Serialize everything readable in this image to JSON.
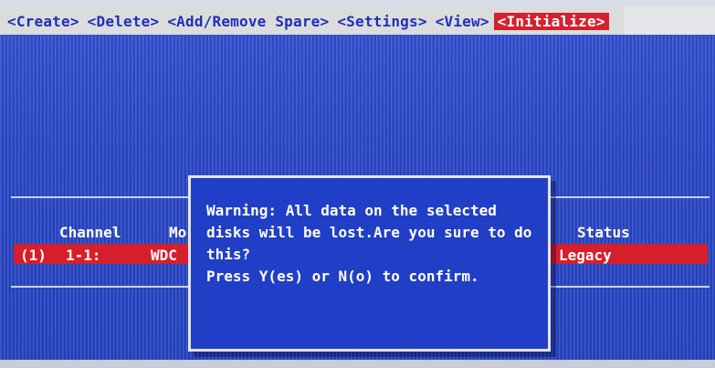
{
  "menu": {
    "items": [
      "<Create>",
      "<Delete>",
      "<Add/Remove Spare>",
      "<Settings>",
      "<View>"
    ],
    "active_item": "<Initialize>"
  },
  "table": {
    "headers": {
      "channel": "Channel",
      "model": "Mo",
      "status": "Status"
    },
    "row": {
      "index": "(1)",
      "channel": "1-1:",
      "model": "WDC",
      "status": "Legacy"
    }
  },
  "dialog": {
    "lines": [
      "Warning: All data on the selected",
      "disks will be lost.Are you sure to do",
      "this?",
      "Press Y(es) or N(o) to confirm."
    ]
  },
  "colors": {
    "background": "#2b49c9",
    "menu_bar": "#dcdcdc",
    "menu_text": "#1e2fb8",
    "highlight": "#d3212f",
    "dialog_bg": "#213fc6"
  }
}
